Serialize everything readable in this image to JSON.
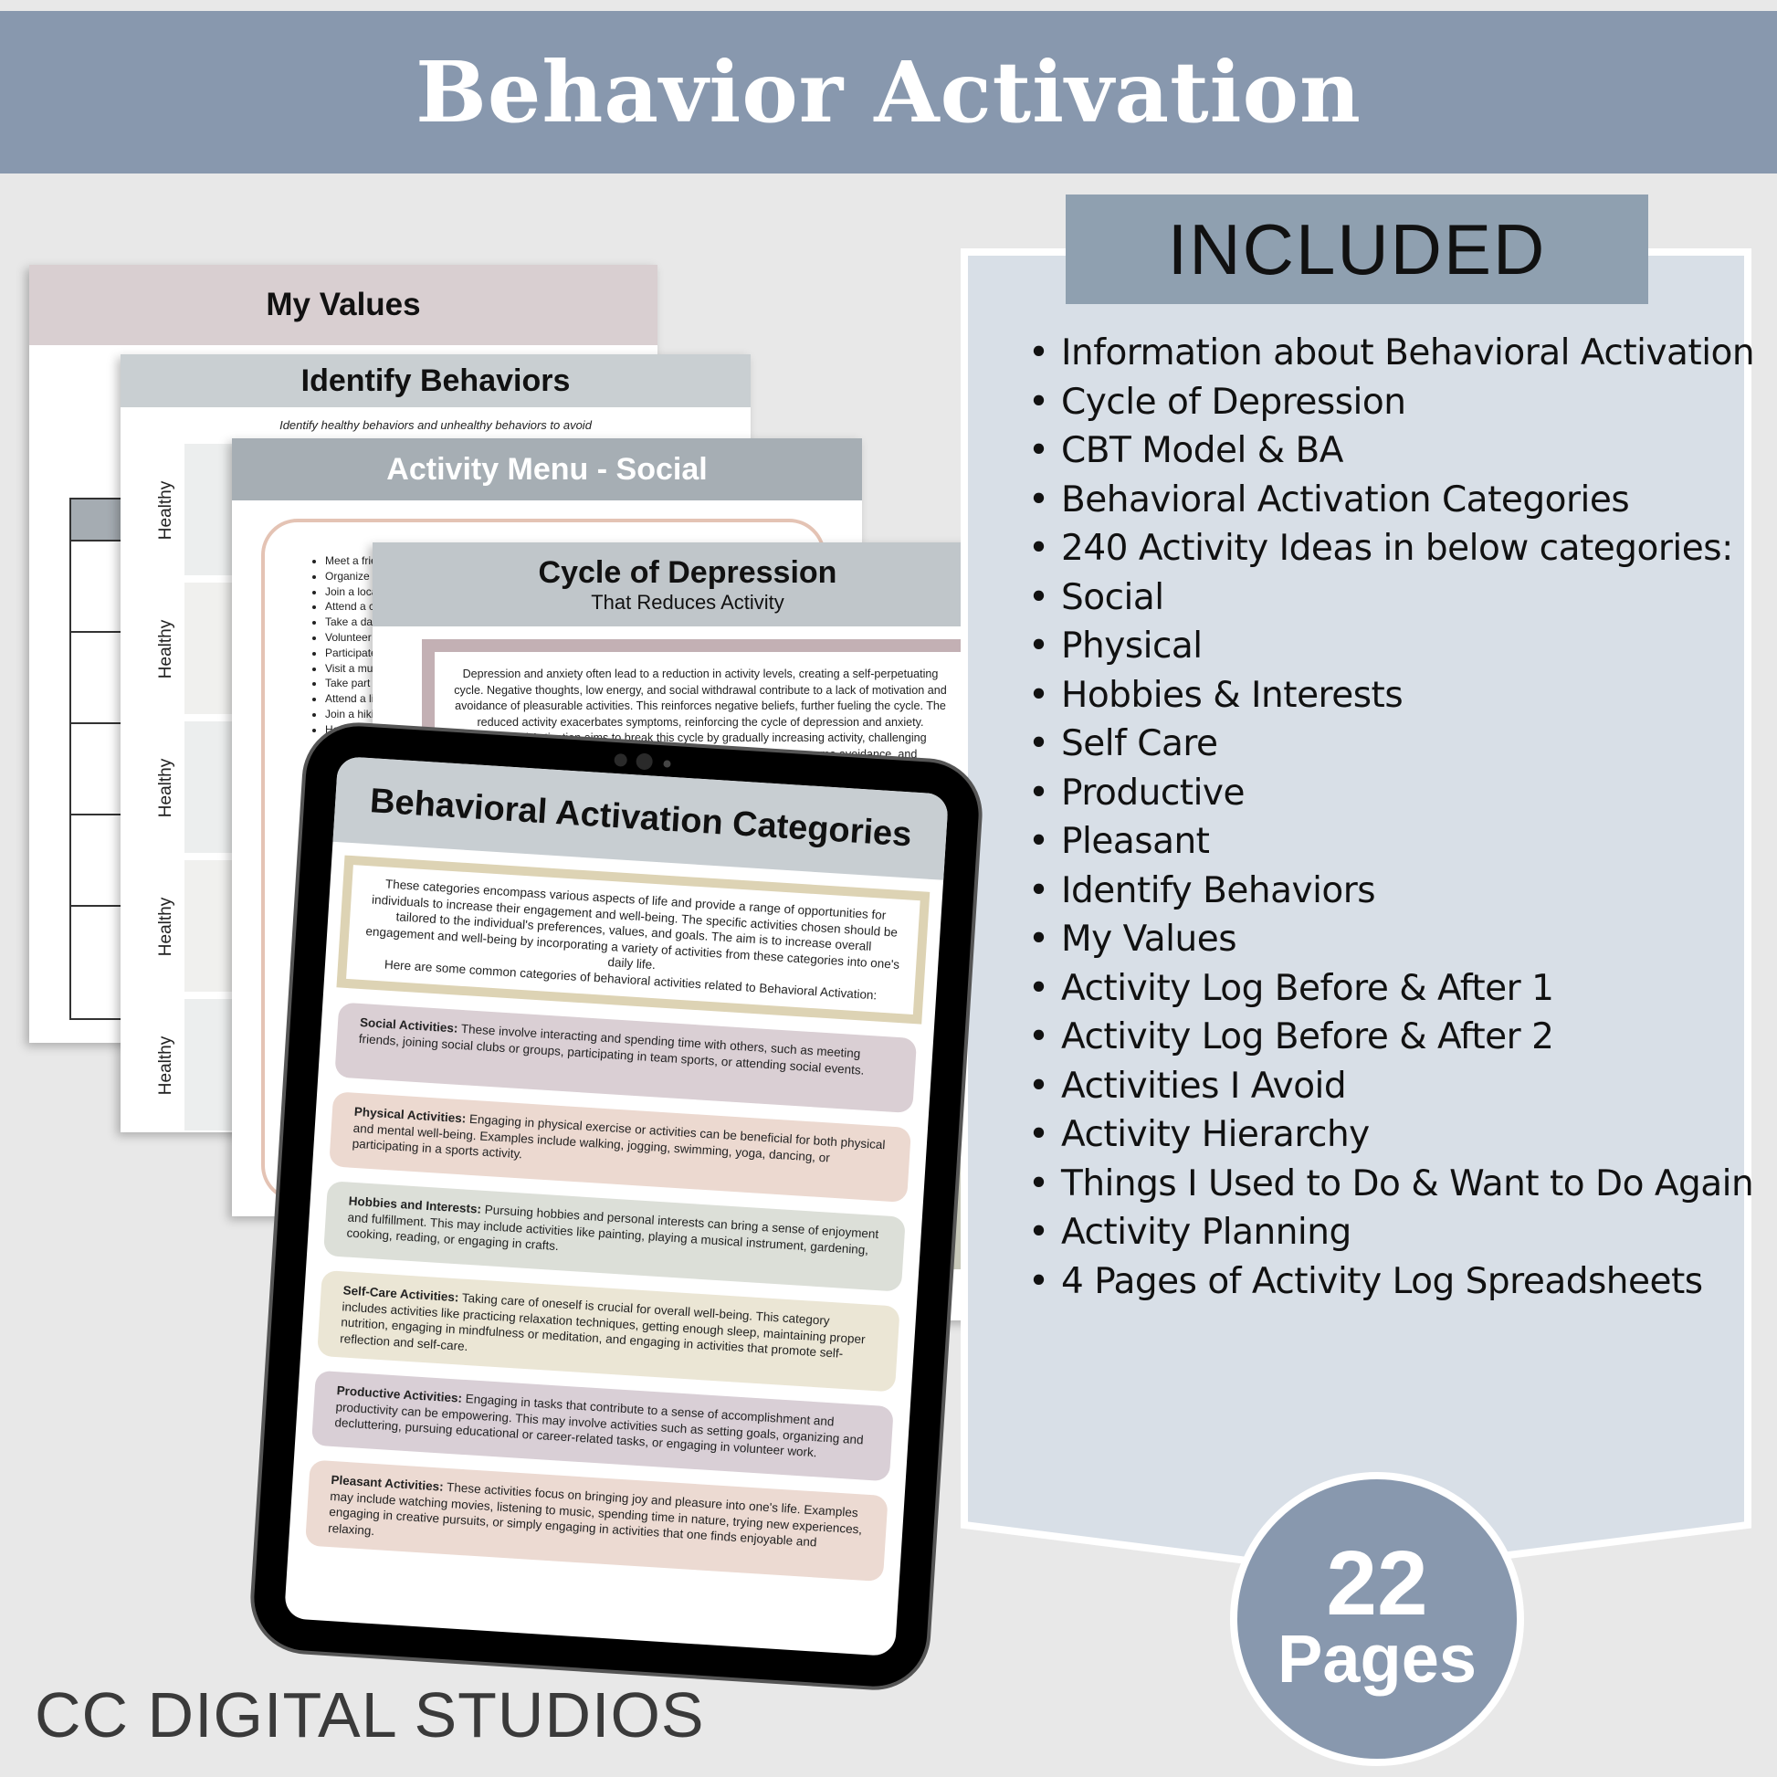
{
  "header": {
    "title": "Behavior Activation"
  },
  "sheets": {
    "my_values": {
      "title": "My Values"
    },
    "identify_behaviors": {
      "title": "Identify Behaviors",
      "subtitle": "Identify healthy behaviors and unhealthy behaviors to avoid",
      "row_labels": [
        "Healthy",
        "Healthy",
        "Healthy",
        "Healthy",
        "Healthy"
      ]
    },
    "activity_menu": {
      "title": "Activity Menu - Social",
      "items": [
        "Meet a frie",
        "Organize a",
        "Join a loca",
        "Attend a co",
        "Take a dan",
        "Volunteer a",
        "Participate",
        "Visit a mus",
        "Take part i",
        "Attend a liv",
        "Join a hikin",
        "Host a potl"
      ]
    },
    "cycle_of_depression": {
      "title": "Cycle of Depression",
      "subtitle": "That Reduces Activity",
      "body": "Depression and anxiety often lead to a reduction in activity levels, creating a self-perpetuating cycle. Negative thoughts, low energy, and social withdrawal contribute to a lack of motivation and avoidance of pleasurable activities. This reinforces negative beliefs, further fueling the cycle. The reduced activity exacerbates symptoms, reinforcing the cycle of depression and anxiety. Behavioral Activation aims to break this cycle by gradually increasing activity, challenging negative thoughts, and reintroducing enjoyable activities to overcome avoidance, and",
      "side_fragments": [
        "t",
        "es"
      ]
    }
  },
  "tablet": {
    "title": "Behavioral Activation Categories",
    "intro": "These categories encompass various aspects of life and provide a range of opportunities for individuals to increase their engagement and well-being.  The specific activities chosen should be tailored to the individual's preferences, values, and goals. The aim is to increase overall engagement and well-being by incorporating a variety of activities from these categories into one's daily life.",
    "intro_tail": "Here are some common categories of behavioral activities related to Behavioral Activation:",
    "categories": [
      {
        "name": "Social Activities:",
        "text": " These involve interacting and spending time with others, such as meeting friends, joining social clubs or groups, participating in team sports, or attending social events.",
        "color": "#dacfd4"
      },
      {
        "name": "Physical Activities:",
        "text": " Engaging in physical exercise or activities can be beneficial for both physical and mental well-being. Examples include walking, jogging, swimming, yoga, dancing, or participating in a sports activity.",
        "color": "#ecd9d0"
      },
      {
        "name": "Hobbies and Interests:",
        "text": " Pursuing hobbies and personal interests can bring a sense of enjoyment and fulfillment. This may include activities like painting, playing a musical instrument, gardening, cooking, reading, or engaging in crafts.",
        "color": "#dcdfd8"
      },
      {
        "name": "Self-Care Activities:",
        "text": " Taking care of oneself is crucial for overall well-being. This category includes activities like practicing relaxation techniques, getting enough sleep, maintaining proper nutrition, engaging in mindfulness or meditation, and engaging in activities that promote self-reflection and self-care.",
        "color": "#ebe6d5"
      },
      {
        "name": "Productive Activities:",
        "text": " Engaging in tasks that contribute to a sense of accomplishment and productivity can be empowering. This may involve activities such as setting goals, organizing and decluttering, pursuing educational or career-related tasks, or engaging in volunteer work.",
        "color": "#d9cfd6"
      },
      {
        "name": "Pleasant Activities:",
        "text": " These activities focus on bringing joy and pleasure into one's life. Examples may include watching movies, listening to music, spending time in nature, trying new experiences, engaging in creative pursuits, or simply engaging in activities that one finds enjoyable and relaxing.",
        "color": "#ecdad2"
      }
    ]
  },
  "included": {
    "label": "INCLUDED",
    "items": [
      "Information about Behavioral Activation",
      "Cycle of Depression",
      "CBT Model & BA",
      "Behavioral Activation Categories",
      "240 Activity Ideas in below categories:",
      "Social",
      "Physical",
      "Hobbies & Interests",
      "Self Care",
      "Productive",
      "Pleasant",
      "Identify Behaviors",
      "My Values",
      "Activity Log Before & After 1",
      "Activity Log Before & After 2",
      "Activities I Avoid",
      "Activity Hierarchy",
      "Things I Used to Do & Want to Do Again",
      "Activity Planning",
      "4 Pages of Activity Log Spreadsheets"
    ]
  },
  "badge": {
    "count": "22",
    "unit": "Pages"
  },
  "brand": "CC DIGITAL STUDIOS",
  "colors": {
    "header_bg": "#8898ae",
    "included_label_bg": "#8fa0b0",
    "included_panel_bg": "#d8dfe7",
    "page_bg": "#e8e8e8"
  }
}
